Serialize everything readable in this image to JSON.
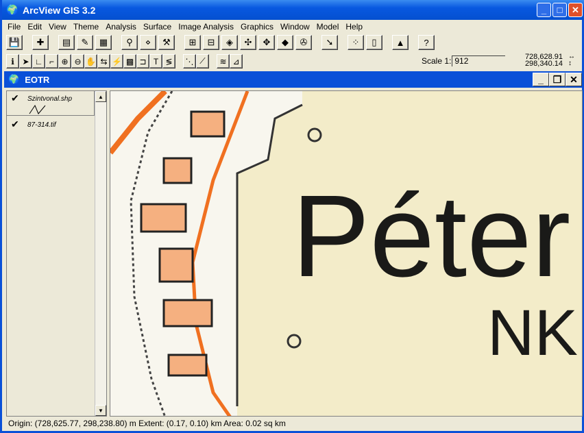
{
  "app": {
    "title": "ArcView GIS 3.2"
  },
  "menu": [
    "File",
    "Edit",
    "View",
    "Theme",
    "Analysis",
    "Surface",
    "Image Analysis",
    "Graphics",
    "Window",
    "Model",
    "Help"
  ],
  "toolbar1": [
    [
      "save-icon",
      "💾"
    ],
    null,
    [
      "add-theme-icon",
      "✚"
    ],
    null,
    [
      "theme-properties-icon",
      "▤"
    ],
    [
      "edit-legend-icon",
      "✎"
    ],
    [
      "open-table-icon",
      "▦"
    ],
    null,
    [
      "find-icon",
      "⚲"
    ],
    [
      "locate-address-icon",
      "⋄"
    ],
    [
      "query-builder-icon",
      "⚒"
    ],
    null,
    [
      "zoom-full-extent-icon",
      "⊞"
    ],
    [
      "zoom-active-themes-icon",
      "⊟"
    ],
    [
      "zoom-selected-icon",
      "◈"
    ],
    [
      "zoom-in-icon",
      "✣"
    ],
    [
      "zoom-out-icon",
      "✥"
    ],
    [
      "zoom-previous-icon",
      "◆"
    ],
    [
      "select-by-theme-icon",
      "✇"
    ],
    null,
    [
      "clear-selected-icon",
      "➘"
    ],
    null,
    [
      "create-chart-icon",
      "⁘"
    ],
    [
      "layout-icon",
      "▯"
    ],
    null,
    [
      "histogram-icon",
      "▲"
    ],
    null,
    [
      "help-icon",
      "?"
    ]
  ],
  "toolbar2": [
    [
      "identify-icon",
      "ℹ"
    ],
    [
      "pointer-icon",
      "➤"
    ],
    [
      "vertex-edit-icon",
      "∟"
    ],
    [
      "select-feature-icon",
      "⌐"
    ],
    [
      "zoom-in-tool-icon",
      "⊕"
    ],
    [
      "zoom-out-tool-icon",
      "⊖"
    ],
    [
      "pan-icon",
      "✋"
    ],
    [
      "measure-icon",
      "⇆"
    ],
    [
      "hot-link-icon",
      "⚡"
    ],
    [
      "area-of-interest-icon",
      "▩"
    ],
    [
      "label-icon",
      "⊐"
    ],
    [
      "text-icon",
      "T"
    ],
    [
      "draw-icon",
      "≶"
    ],
    null,
    [
      "snap-icon",
      "⋱"
    ],
    [
      "line-tool-icon",
      "⟋"
    ],
    null,
    [
      "contour-icon",
      "≋"
    ],
    [
      "spot-icon",
      "⊿"
    ]
  ],
  "scale": {
    "label": "Scale 1:",
    "value": "912"
  },
  "coords": {
    "x": "728,628.91",
    "y": "298,340.14"
  },
  "view": {
    "title": "EOTR"
  },
  "toc": [
    {
      "label": "Szintvonal.shp",
      "checked": true
    },
    {
      "label": "87-314.tif",
      "checked": true
    }
  ],
  "map": {
    "label1": "Péter",
    "label2": "NK"
  },
  "status": "Origin: (728,625.77, 298,238.80) m  Extent: (0.17, 0.10) km  Area: 0.02 sq km",
  "colors": {
    "titlebar": "#0a50d8",
    "face": "#ece9d8",
    "road": "#f07020"
  }
}
